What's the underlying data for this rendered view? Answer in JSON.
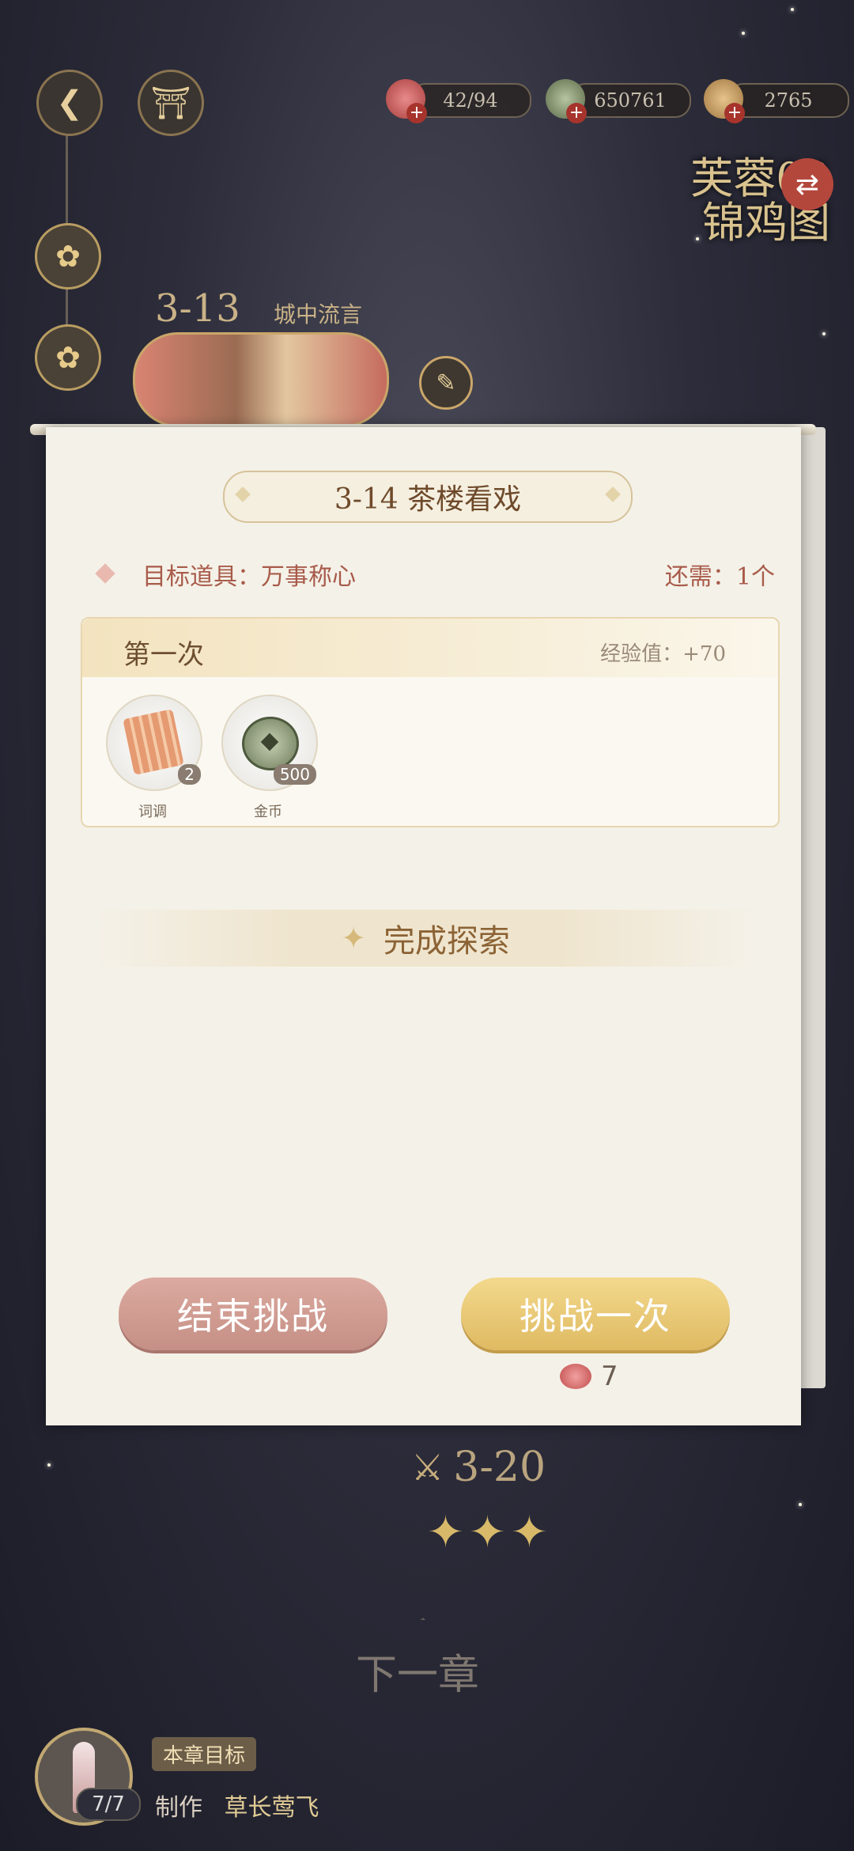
{
  "top_bar": {
    "resources": [
      {
        "name": "lotus-stamina",
        "value": "42/94",
        "icon": "lotus-icon",
        "color": "#c45a5a"
      },
      {
        "name": "copper-coin",
        "value": "650761",
        "icon": "coin-icon",
        "color": "#7c8a6a"
      },
      {
        "name": "gold-ingot",
        "value": "2765",
        "icon": "ingot-icon",
        "color": "#c59a55"
      }
    ]
  },
  "chapter": {
    "line1": "芙蓉03",
    "line2": "锦鸡图"
  },
  "map": {
    "stage_prev_number": "3-13",
    "stage_prev_name": "城中流言",
    "stage_next": "3-20",
    "next_chapter": "下一章"
  },
  "dialog": {
    "title": "3-14 茶楼看戏",
    "target_label": "目标道具：万事称心",
    "need_label": "还需：1个",
    "reward_header": "第一次",
    "exp_label": "经验值：+70",
    "rewards": [
      {
        "label": "词调",
        "count": "2",
        "icon": "scroll-icon"
      },
      {
        "label": "金币",
        "count": "500",
        "icon": "coin-icon"
      }
    ],
    "complete_text": "完成探索",
    "end_button": "结束挑战",
    "challenge_button": "挑战一次",
    "cost_value": "7"
  },
  "goal": {
    "label": "本章目标",
    "progress": "7/7",
    "task_prefix": "制作",
    "task_name": "草长莺飞"
  }
}
